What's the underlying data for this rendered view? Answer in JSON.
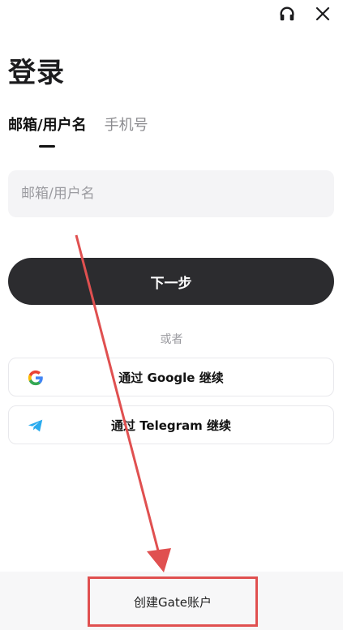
{
  "header": {
    "support_icon": "headset-icon",
    "close_icon": "close-icon"
  },
  "title": "登录",
  "tabs": [
    {
      "label": "邮箱/用户名",
      "active": true
    },
    {
      "label": "手机号",
      "active": false
    }
  ],
  "login_input": {
    "placeholder": "邮箱/用户名",
    "value": ""
  },
  "next_button": {
    "label": "下一步"
  },
  "divider_text": "或者",
  "social_buttons": [
    {
      "label": "通过 Google 继续",
      "icon": "google-icon"
    },
    {
      "label": "通过 Telegram 继续",
      "icon": "telegram-icon"
    }
  ],
  "footer": {
    "create_account_label": "创建Gate账户"
  },
  "annotation": {
    "color": "#e05050"
  }
}
